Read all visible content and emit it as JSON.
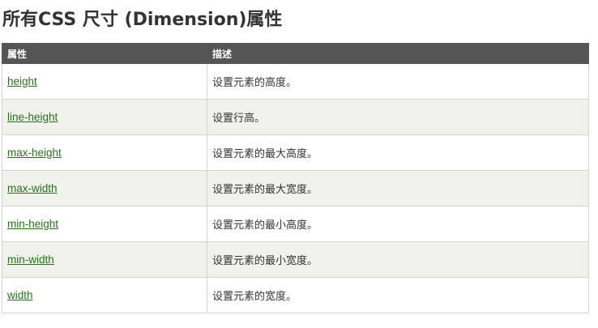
{
  "title": "所有CSS 尺寸 (Dimension)属性",
  "table": {
    "headers": [
      "属性",
      "描述"
    ],
    "rows": [
      {
        "property": "height",
        "description": "设置元素的高度。"
      },
      {
        "property": "line-height",
        "description": "设置行高。"
      },
      {
        "property": "max-height",
        "description": "设置元素的最大高度。"
      },
      {
        "property": "max-width",
        "description": "设置元素的最大宽度。"
      },
      {
        "property": "min-height",
        "description": "设置元素的最小高度。"
      },
      {
        "property": "min-width",
        "description": "设置元素的最小宽度。"
      },
      {
        "property": "width",
        "description": "设置元素的宽度。"
      }
    ]
  },
  "colors": {
    "header_bg": "#555555",
    "link": "#2b6e1f",
    "alt_row": "#f1f1ec"
  }
}
